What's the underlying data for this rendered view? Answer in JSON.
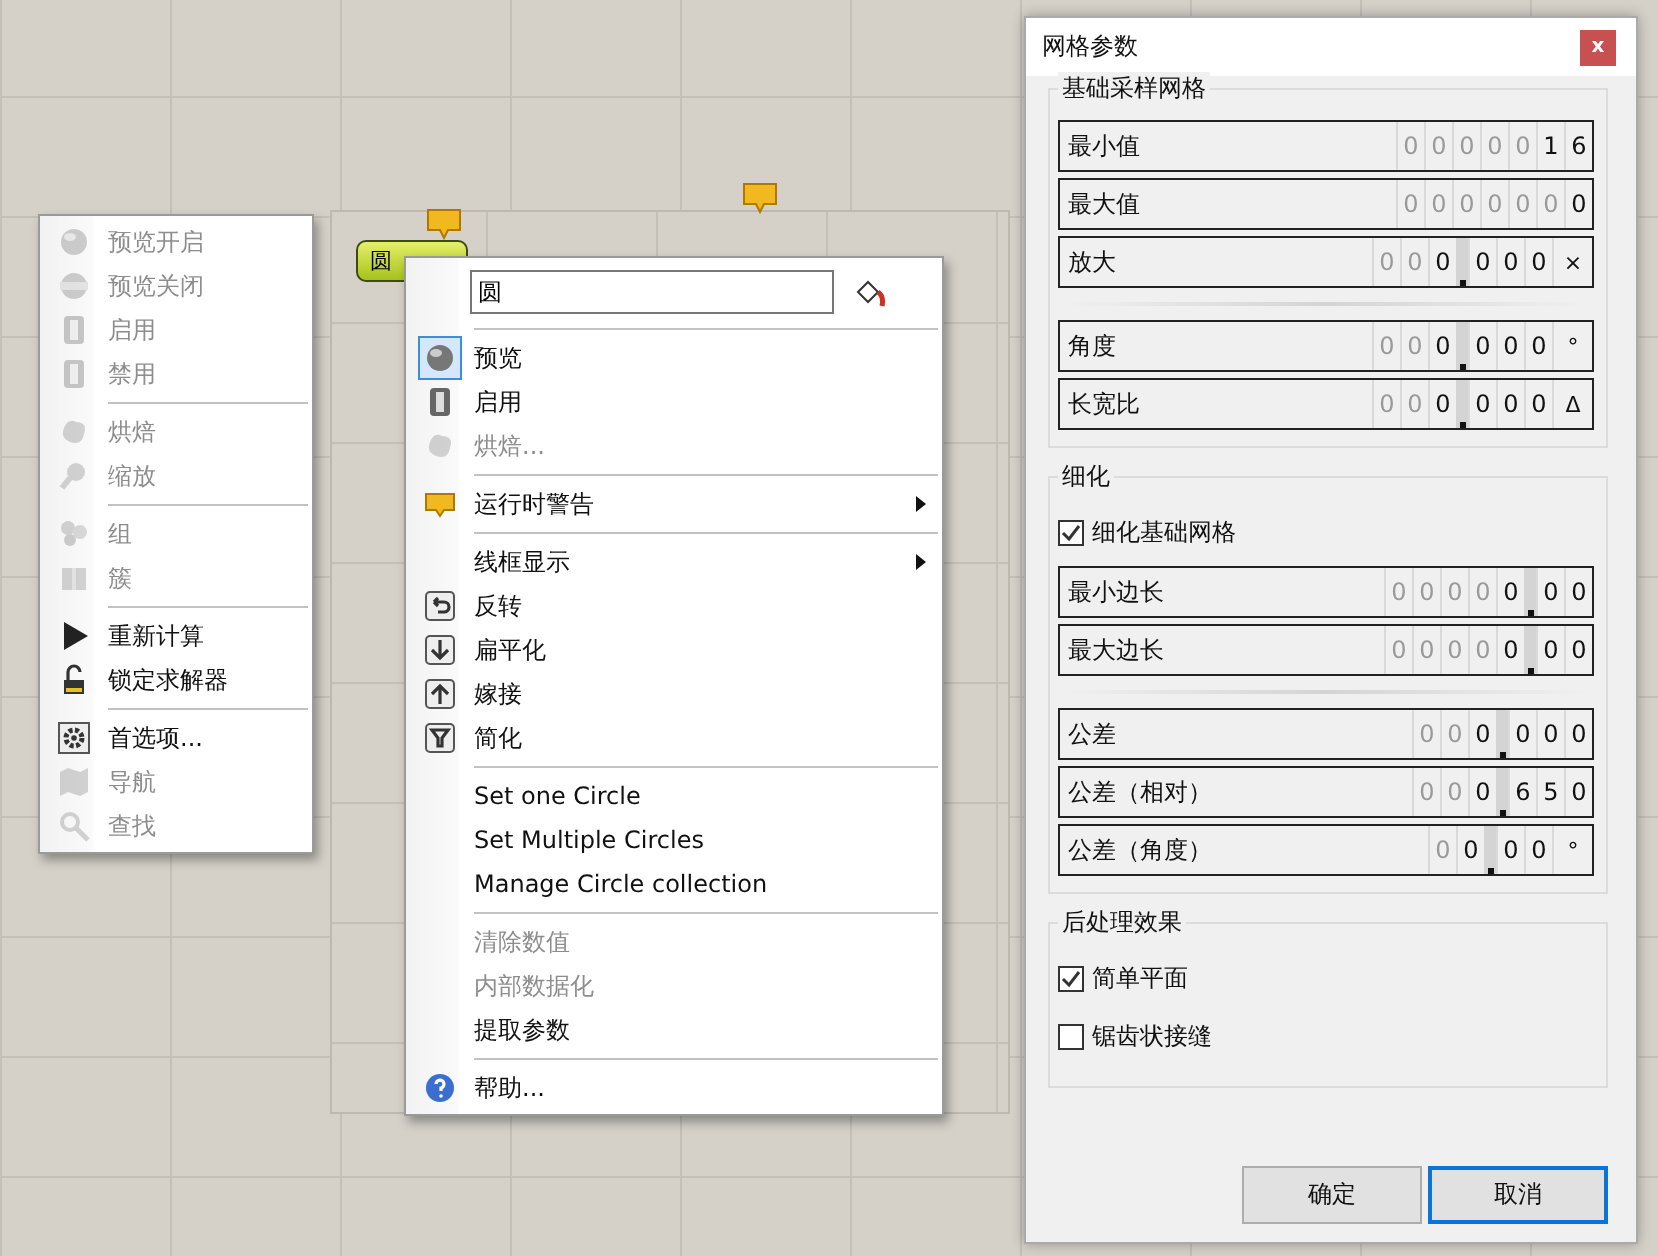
{
  "canvas": {
    "node_label": "圆"
  },
  "left_menu": {
    "sections": [
      [
        {
          "label": "预览开启",
          "disabled": true
        },
        {
          "label": "预览关闭",
          "disabled": true
        },
        {
          "label": "启用",
          "disabled": true
        },
        {
          "label": "禁用",
          "disabled": true
        }
      ],
      [
        {
          "label": "烘焙",
          "disabled": true
        },
        {
          "label": "缩放",
          "disabled": true
        }
      ],
      [
        {
          "label": "组",
          "disabled": true
        },
        {
          "label": "簇",
          "disabled": true
        }
      ],
      [
        {
          "label": "重新计算",
          "disabled": false
        },
        {
          "label": "锁定求解器",
          "disabled": false
        }
      ],
      [
        {
          "label": "首选项...",
          "disabled": false
        },
        {
          "label": "导航",
          "disabled": true
        },
        {
          "label": "查找",
          "disabled": true
        }
      ]
    ]
  },
  "context_menu": {
    "name_field": {
      "value": "圆"
    },
    "sections": [
      [
        {
          "label": "预览",
          "disabled": false,
          "checked": true,
          "submenu": false
        },
        {
          "label": "启用",
          "disabled": false,
          "checked": false,
          "submenu": false
        },
        {
          "label": "烘焙...",
          "disabled": true,
          "checked": false,
          "submenu": false
        }
      ],
      [
        {
          "label": "运行时警告",
          "disabled": false,
          "checked": false,
          "submenu": true
        }
      ],
      [
        {
          "label": "线框显示",
          "disabled": false,
          "checked": false,
          "submenu": true
        },
        {
          "label": "反转",
          "disabled": false,
          "checked": false,
          "submenu": false
        },
        {
          "label": "扁平化",
          "disabled": false,
          "checked": false,
          "submenu": false
        },
        {
          "label": "嫁接",
          "disabled": false,
          "checked": false,
          "submenu": false
        },
        {
          "label": "简化",
          "disabled": false,
          "checked": false,
          "submenu": false
        }
      ],
      [
        {
          "label": "Set one Circle",
          "disabled": false,
          "checked": false,
          "submenu": false
        },
        {
          "label": "Set Multiple Circles",
          "disabled": false,
          "checked": false,
          "submenu": false
        },
        {
          "label": "Manage Circle collection",
          "disabled": false,
          "checked": false,
          "submenu": false
        }
      ],
      [
        {
          "label": "清除数值",
          "disabled": true,
          "checked": false,
          "submenu": false
        },
        {
          "label": "内部数据化",
          "disabled": true,
          "checked": false,
          "submenu": false
        },
        {
          "label": "提取参数",
          "disabled": false,
          "checked": false,
          "submenu": false
        }
      ],
      [
        {
          "label": "帮助...",
          "disabled": false,
          "checked": false,
          "submenu": false
        }
      ]
    ]
  },
  "dialog": {
    "title": "网格参数",
    "close": "x",
    "groups": [
      {
        "title": "基础采样网格",
        "blocks": [
          [
            {
              "label": "最小值",
              "digits": [
                {
                  "d": "0",
                  "dim": true,
                  "point_after": false
                },
                {
                  "d": "0",
                  "dim": true,
                  "point_after": false
                },
                {
                  "d": "0",
                  "dim": true,
                  "point_after": false
                },
                {
                  "d": "0",
                  "dim": true,
                  "point_after": false
                },
                {
                  "d": "0",
                  "dim": true,
                  "point_after": false
                },
                {
                  "d": "1",
                  "dim": false,
                  "point_after": false
                },
                {
                  "d": "6",
                  "dim": false,
                  "point_after": false
                }
              ]
            },
            {
              "label": "最大值",
              "digits": [
                {
                  "d": "0",
                  "dim": true,
                  "point_after": false
                },
                {
                  "d": "0",
                  "dim": true,
                  "point_after": false
                },
                {
                  "d": "0",
                  "dim": true,
                  "point_after": false
                },
                {
                  "d": "0",
                  "dim": true,
                  "point_after": false
                },
                {
                  "d": "0",
                  "dim": true,
                  "point_after": false
                },
                {
                  "d": "0",
                  "dim": true,
                  "point_after": false
                },
                {
                  "d": "0",
                  "dim": false,
                  "point_after": false
                }
              ]
            },
            {
              "label": "放大",
              "unit": "×",
              "digits": [
                {
                  "d": "0",
                  "dim": true,
                  "point_after": false
                },
                {
                  "d": "0",
                  "dim": true,
                  "point_after": false
                },
                {
                  "d": "0",
                  "dim": false,
                  "point_after": true
                },
                {
                  "d": "0",
                  "dim": false,
                  "point_after": false
                },
                {
                  "d": "0",
                  "dim": false,
                  "point_after": false
                },
                {
                  "d": "0",
                  "dim": false,
                  "point_after": false
                }
              ]
            }
          ],
          [
            {
              "label": "角度",
              "unit": "°",
              "digits": [
                {
                  "d": "0",
                  "dim": true,
                  "point_after": false
                },
                {
                  "d": "0",
                  "dim": true,
                  "point_after": false
                },
                {
                  "d": "0",
                  "dim": false,
                  "point_after": true
                },
                {
                  "d": "0",
                  "dim": false,
                  "point_after": false
                },
                {
                  "d": "0",
                  "dim": false,
                  "point_after": false
                },
                {
                  "d": "0",
                  "dim": false,
                  "point_after": false
                }
              ]
            },
            {
              "label": "长宽比",
              "unit": "Δ",
              "digits": [
                {
                  "d": "0",
                  "dim": true,
                  "point_after": false
                },
                {
                  "d": "0",
                  "dim": true,
                  "point_after": false
                },
                {
                  "d": "0",
                  "dim": false,
                  "point_after": true
                },
                {
                  "d": "0",
                  "dim": false,
                  "point_after": false
                },
                {
                  "d": "0",
                  "dim": false,
                  "point_after": false
                },
                {
                  "d": "0",
                  "dim": false,
                  "point_after": false
                }
              ]
            }
          ]
        ]
      },
      {
        "title": "细化",
        "checkboxes": [
          {
            "label": "细化基础网格",
            "checked": true
          }
        ],
        "blocks": [
          [
            {
              "label": "最小边长",
              "digits": [
                {
                  "d": "0",
                  "dim": true,
                  "point_after": false
                },
                {
                  "d": "0",
                  "dim": true,
                  "point_after": false
                },
                {
                  "d": "0",
                  "dim": true,
                  "point_after": false
                },
                {
                  "d": "0",
                  "dim": true,
                  "point_after": false
                },
                {
                  "d": "0",
                  "dim": false,
                  "point_after": true
                },
                {
                  "d": "0",
                  "dim": false,
                  "point_after": false
                },
                {
                  "d": "0",
                  "dim": false,
                  "point_after": false
                }
              ]
            },
            {
              "label": "最大边长",
              "digits": [
                {
                  "d": "0",
                  "dim": true,
                  "point_after": false
                },
                {
                  "d": "0",
                  "dim": true,
                  "point_after": false
                },
                {
                  "d": "0",
                  "dim": true,
                  "point_after": false
                },
                {
                  "d": "0",
                  "dim": true,
                  "point_after": false
                },
                {
                  "d": "0",
                  "dim": false,
                  "point_after": true
                },
                {
                  "d": "0",
                  "dim": false,
                  "point_after": false
                },
                {
                  "d": "0",
                  "dim": false,
                  "point_after": false
                }
              ]
            }
          ],
          [
            {
              "label": "公差",
              "digits": [
                {
                  "d": "0",
                  "dim": true,
                  "point_after": false
                },
                {
                  "d": "0",
                  "dim": true,
                  "point_after": false
                },
                {
                  "d": "0",
                  "dim": false,
                  "point_after": true
                },
                {
                  "d": "0",
                  "dim": false,
                  "point_after": false
                },
                {
                  "d": "0",
                  "dim": false,
                  "point_after": false
                },
                {
                  "d": "0",
                  "dim": false,
                  "point_after": false
                }
              ]
            },
            {
              "label": "公差（相对）",
              "digits": [
                {
                  "d": "0",
                  "dim": true,
                  "point_after": false
                },
                {
                  "d": "0",
                  "dim": true,
                  "point_after": false
                },
                {
                  "d": "0",
                  "dim": false,
                  "point_after": true
                },
                {
                  "d": "6",
                  "dim": false,
                  "point_after": false
                },
                {
                  "d": "5",
                  "dim": false,
                  "point_after": false
                },
                {
                  "d": "0",
                  "dim": false,
                  "point_after": false
                }
              ]
            },
            {
              "label": "公差（角度）",
              "unit": "°",
              "digits": [
                {
                  "d": "0",
                  "dim": true,
                  "point_after": false
                },
                {
                  "d": "0",
                  "dim": false,
                  "point_after": true
                },
                {
                  "d": "0",
                  "dim": false,
                  "point_after": false
                },
                {
                  "d": "0",
                  "dim": false,
                  "point_after": false
                }
              ]
            }
          ]
        ]
      },
      {
        "title": "后处理效果",
        "checkboxes": [
          {
            "label": "简单平面",
            "checked": true
          },
          {
            "label": "锯齿状接缝",
            "checked": false
          }
        ]
      }
    ],
    "buttons": [
      {
        "label": "确定",
        "selected": false
      },
      {
        "label": "取消",
        "selected": true
      }
    ]
  }
}
